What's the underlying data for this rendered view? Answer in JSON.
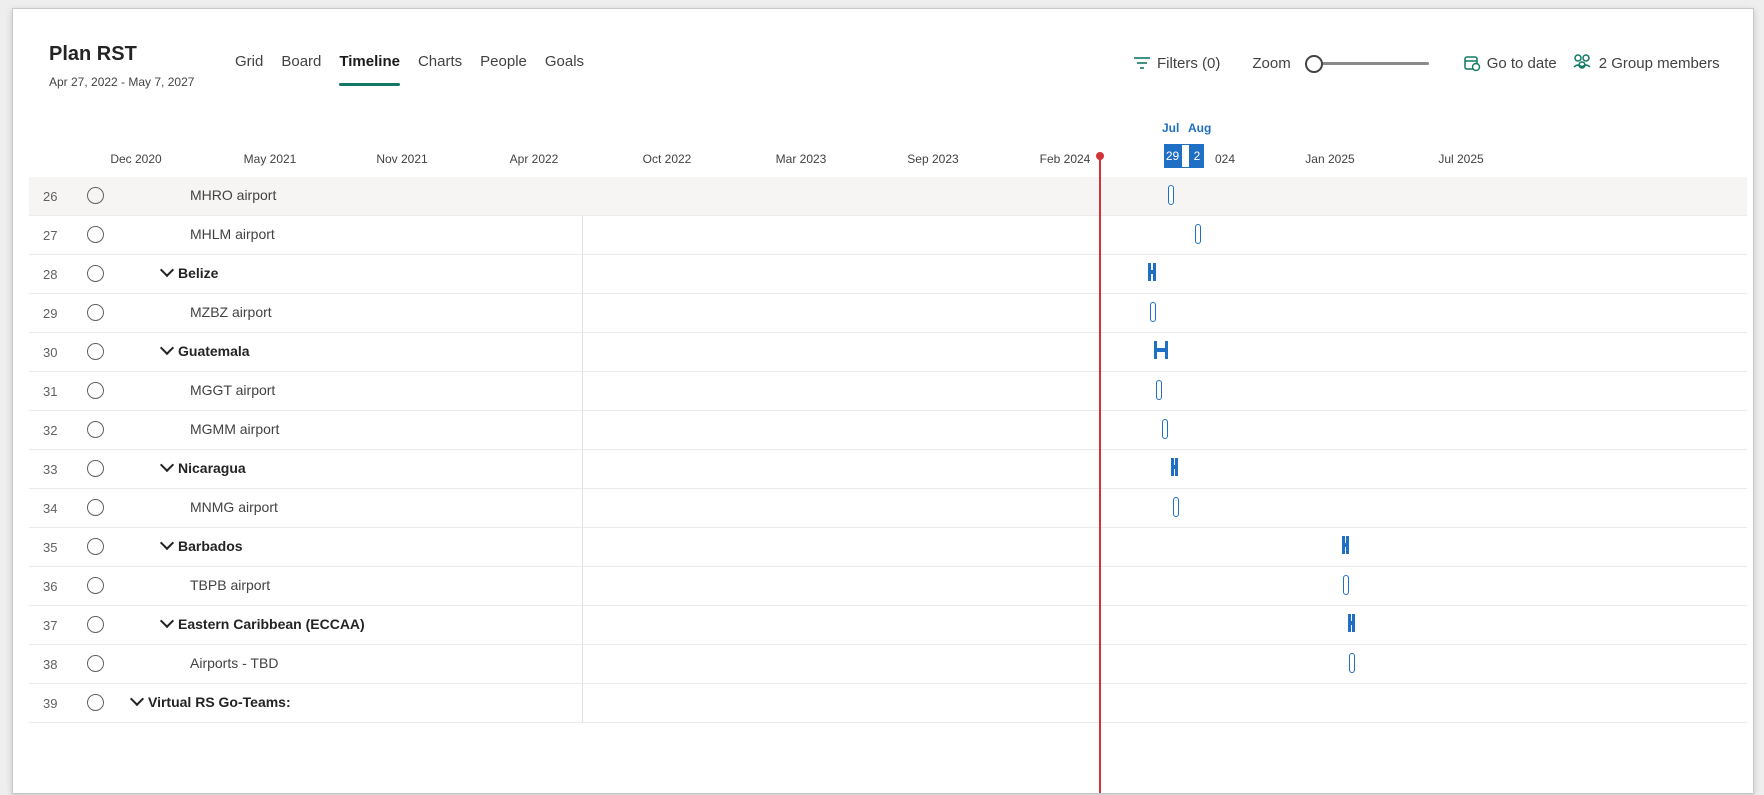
{
  "plan": {
    "title": "Plan RST",
    "dates": "Apr 27, 2022 - May 7, 2027"
  },
  "tabs": [
    {
      "label": "Grid"
    },
    {
      "label": "Board"
    },
    {
      "label": "Timeline",
      "active": true
    },
    {
      "label": "Charts"
    },
    {
      "label": "People"
    },
    {
      "label": "Goals"
    }
  ],
  "toolbar": {
    "filters_label": "Filters (0)",
    "zoom_label": "Zoom",
    "go_to_date_label": "Go to date",
    "group_members_label": "2 Group members",
    "zoom_level": 0
  },
  "timeline": {
    "top_months": [
      "Jul",
      "Aug"
    ],
    "months": [
      "Dec 2020",
      "May 2021",
      "Nov 2021",
      "Apr 2022",
      "Oct 2022",
      "Mar 2023",
      "Sep 2023",
      "Feb 2024",
      "Jan 2025",
      "Jul 2025"
    ],
    "highlighted_days": [
      "29",
      "2"
    ],
    "partial_label": "024",
    "today_marker_color": "#d13438",
    "accent_color": "#1f6fc5"
  },
  "rows": [
    {
      "num": "26",
      "label": "MHRO airport",
      "type": "task",
      "level": 2,
      "hover": true
    },
    {
      "num": "27",
      "label": "MHLM airport",
      "type": "task",
      "level": 2
    },
    {
      "num": "28",
      "label": "Belize",
      "type": "group",
      "level": 1
    },
    {
      "num": "29",
      "label": "MZBZ airport",
      "type": "task",
      "level": 2
    },
    {
      "num": "30",
      "label": "Guatemala",
      "type": "group",
      "level": 1
    },
    {
      "num": "31",
      "label": "MGGT airport",
      "type": "task",
      "level": 2
    },
    {
      "num": "32",
      "label": "MGMM airport",
      "type": "task",
      "level": 2
    },
    {
      "num": "33",
      "label": "Nicaragua",
      "type": "group",
      "level": 1
    },
    {
      "num": "34",
      "label": "MNMG airport",
      "type": "task",
      "level": 2
    },
    {
      "num": "35",
      "label": "Barbados",
      "type": "group",
      "level": 1
    },
    {
      "num": "36",
      "label": "TBPB airport",
      "type": "task",
      "level": 2
    },
    {
      "num": "37",
      "label": "Eastern Caribbean (ECCAA)",
      "type": "group",
      "level": 1
    },
    {
      "num": "38",
      "label": "Airports - TBD",
      "type": "task",
      "level": 2
    },
    {
      "num": "39",
      "label": "Virtual RS Go-Teams:",
      "type": "group",
      "level": 0
    }
  ]
}
